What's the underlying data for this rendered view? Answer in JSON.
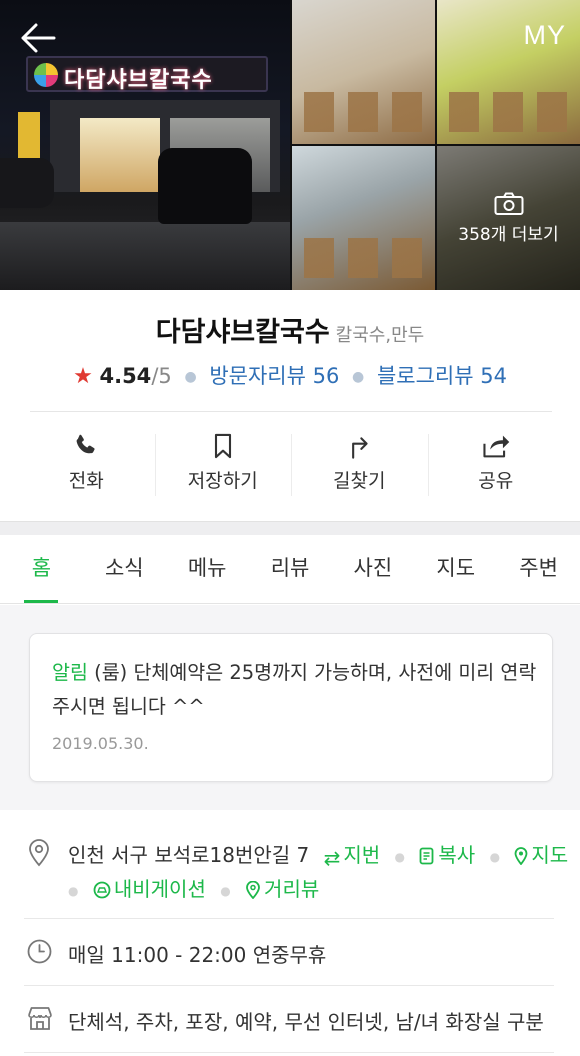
{
  "header": {
    "my_label": "MY",
    "more_photos_label": "358개 더보기",
    "sign_text": "다담샤브칼국수"
  },
  "place": {
    "name": "다담샤브칼국수",
    "category": "칼국수,만두",
    "rating": "4.54",
    "rating_max": "/5",
    "visitor_review": "방문자리뷰 56",
    "blog_review": "블로그리뷰 54"
  },
  "actions": {
    "call": "전화",
    "save": "저장하기",
    "directions": "길찾기",
    "share": "공유"
  },
  "tabs": [
    {
      "label": "홈"
    },
    {
      "label": "소식"
    },
    {
      "label": "메뉴"
    },
    {
      "label": "리뷰"
    },
    {
      "label": "사진"
    },
    {
      "label": "지도"
    },
    {
      "label": "주변"
    }
  ],
  "notice": {
    "tag": "알림",
    "text": " (룸) 단체예약은 25명까지 가능하며, 사전에 미리 연락 주시면 됩니다 ^^",
    "date": "2019.05.30."
  },
  "info": {
    "address": "인천 서구 보석로18번안길 7",
    "jibun": "지번",
    "copy": "복사",
    "map": "지도",
    "navigation": "내비게이션",
    "street_view": "거리뷰",
    "hours": "매일 11:00 - 22:00 연중무휴",
    "amenities": "단체석, 주차, 포장, 예약, 무선 인터넷, 남/녀 화장실 구분"
  },
  "colors": {
    "accent_green": "#1db84a",
    "link_blue": "#2f6fb6",
    "star_red": "#e03a32"
  }
}
